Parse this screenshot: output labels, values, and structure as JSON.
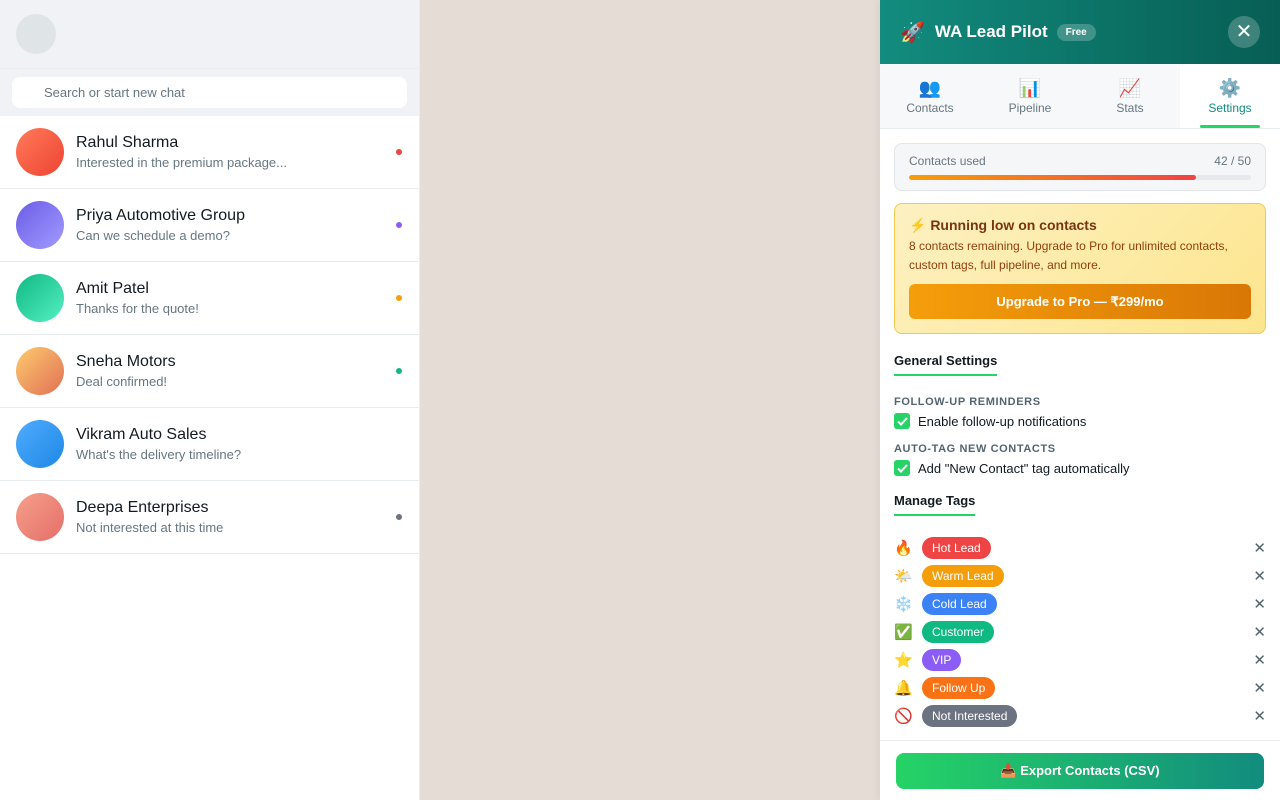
{
  "search": {
    "placeholder": "Search or start new chat"
  },
  "chats": [
    {
      "name": "Rahul Sharma",
      "preview": "Interested in the premium package...",
      "avatar_from": "#ff7a59",
      "avatar_to": "#ee4433",
      "dot": "#ef4444"
    },
    {
      "name": "Priya Automotive Group",
      "preview": "Can we schedule a demo?",
      "avatar_from": "#6c5ce7",
      "avatar_to": "#a29bfe",
      "dot": "#8b5cf6"
    },
    {
      "name": "Amit Patel",
      "preview": "Thanks for the quote!",
      "avatar_from": "#10b981",
      "avatar_to": "#55efc4",
      "dot": "#f59e0b"
    },
    {
      "name": "Sneha Motors",
      "preview": "Deal confirmed!",
      "avatar_from": "#fdcb6e",
      "avatar_to": "#e17055",
      "dot": "#10b981"
    },
    {
      "name": "Vikram Auto Sales",
      "preview": "What's the delivery timeline?",
      "avatar_from": "#4facfe",
      "avatar_to": "#1e88e5",
      "dot": ""
    },
    {
      "name": "Deepa Enterprises",
      "preview": "Not interested at this time",
      "avatar_from": "#f5a08a",
      "avatar_to": "#e56e6a",
      "dot": "#6b7280"
    }
  ],
  "panel": {
    "title": "WA Lead Pilot",
    "badge": "Free",
    "rocket": "🚀",
    "close": "✕"
  },
  "tabs": [
    {
      "icon": "👥",
      "icon_name": "contacts-icon",
      "label": "Contacts",
      "active": false
    },
    {
      "icon": "📊",
      "icon_name": "pipeline-icon",
      "label": "Pipeline",
      "active": false
    },
    {
      "icon": "📈",
      "icon_name": "stats-icon",
      "label": "Stats",
      "active": false
    },
    {
      "icon": "⚙️",
      "icon_name": "settings-icon",
      "label": "Settings",
      "active": true
    }
  ],
  "usage": {
    "label": "Contacts used",
    "count": "42 / 50",
    "used": 42,
    "limit": 50
  },
  "warning": {
    "title": "⚡ Running low on contacts",
    "text": "8 contacts remaining. Upgrade to Pro for unlimited contacts, custom tags, full pipeline, and more.",
    "button": "Upgrade to Pro — ₹299/mo"
  },
  "general": {
    "title": "General Settings",
    "followup_label": "FOLLOW-UP REMINDERS",
    "followup_option": "Enable follow-up notifications",
    "autotag_label": "AUTO-TAG NEW CONTACTS",
    "autotag_option": "Add \"New Contact\" tag automatically"
  },
  "tags_section": {
    "title": "Manage Tags"
  },
  "tags": [
    {
      "emoji": "🔥",
      "label": "Hot Lead",
      "color": "#ef4444"
    },
    {
      "emoji": "🌤️",
      "label": "Warm Lead",
      "color": "#f59e0b"
    },
    {
      "emoji": "❄️",
      "label": "Cold Lead",
      "color": "#3b82f6"
    },
    {
      "emoji": "✅",
      "label": "Customer",
      "color": "#10b981"
    },
    {
      "emoji": "⭐",
      "label": "VIP",
      "color": "#8b5cf6"
    },
    {
      "emoji": "🔔",
      "label": "Follow Up",
      "color": "#f97316"
    },
    {
      "emoji": "🚫",
      "label": "Not Interested",
      "color": "#6b7280"
    }
  ],
  "tag_remove": "✕",
  "checkmark": "✓",
  "footer": {
    "export_button": "📥 Export Contacts (CSV)"
  }
}
